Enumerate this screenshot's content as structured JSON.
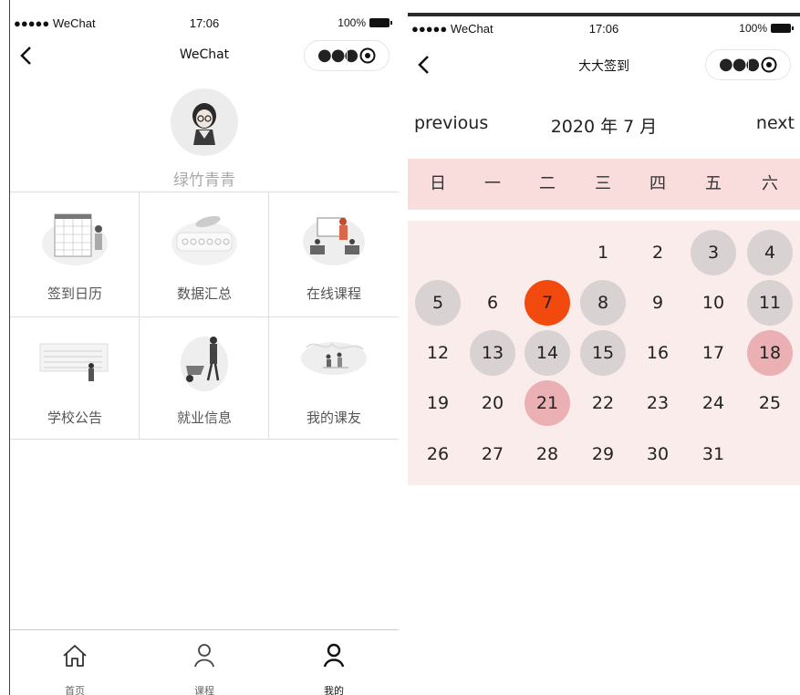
{
  "left_screen": {
    "status": {
      "carrier": "●●●●● WeChat",
      "time": "17:06",
      "battery": "100%"
    },
    "nav": {
      "title": "WeChat"
    },
    "profile": {
      "username": "绿竹青青"
    },
    "grid": [
      {
        "label": "签到日历",
        "icon": "calendar-illustration"
      },
      {
        "label": "数据汇总",
        "icon": "data-illustration"
      },
      {
        "label": "在线课程",
        "icon": "course-illustration"
      },
      {
        "label": "学校公告",
        "icon": "notice-illustration"
      },
      {
        "label": "就业信息",
        "icon": "employment-illustration"
      },
      {
        "label": "我的课友",
        "icon": "friends-illustration"
      }
    ],
    "tabs": [
      {
        "label": "首页",
        "icon": "home-icon"
      },
      {
        "label": "课程",
        "icon": "person-icon"
      },
      {
        "label": "我的",
        "icon": "person-icon",
        "active": true
      }
    ]
  },
  "right_screen": {
    "status": {
      "carrier": "●●●●● WeChat",
      "time": "17:06",
      "battery": "100%"
    },
    "nav": {
      "title": "大大签到"
    },
    "calendar": {
      "prev_label": "previous",
      "month_label": "2020 年 7 月",
      "next_label": "next",
      "weekdays": [
        "日",
        "一",
        "二",
        "三",
        "四",
        "五",
        "六"
      ],
      "first_weekday_index": 3,
      "days_in_month": 31,
      "today": 7,
      "signed_days": [
        3,
        4,
        5,
        8,
        11,
        13,
        14,
        15
      ],
      "special_days": [
        18,
        21
      ],
      "colors": {
        "today": "#f2490e",
        "signed": "#d9d2d2",
        "special": "#eab0b4",
        "weekday_bar": "#f9dcdc",
        "days_bg": "#fbecec"
      }
    }
  }
}
